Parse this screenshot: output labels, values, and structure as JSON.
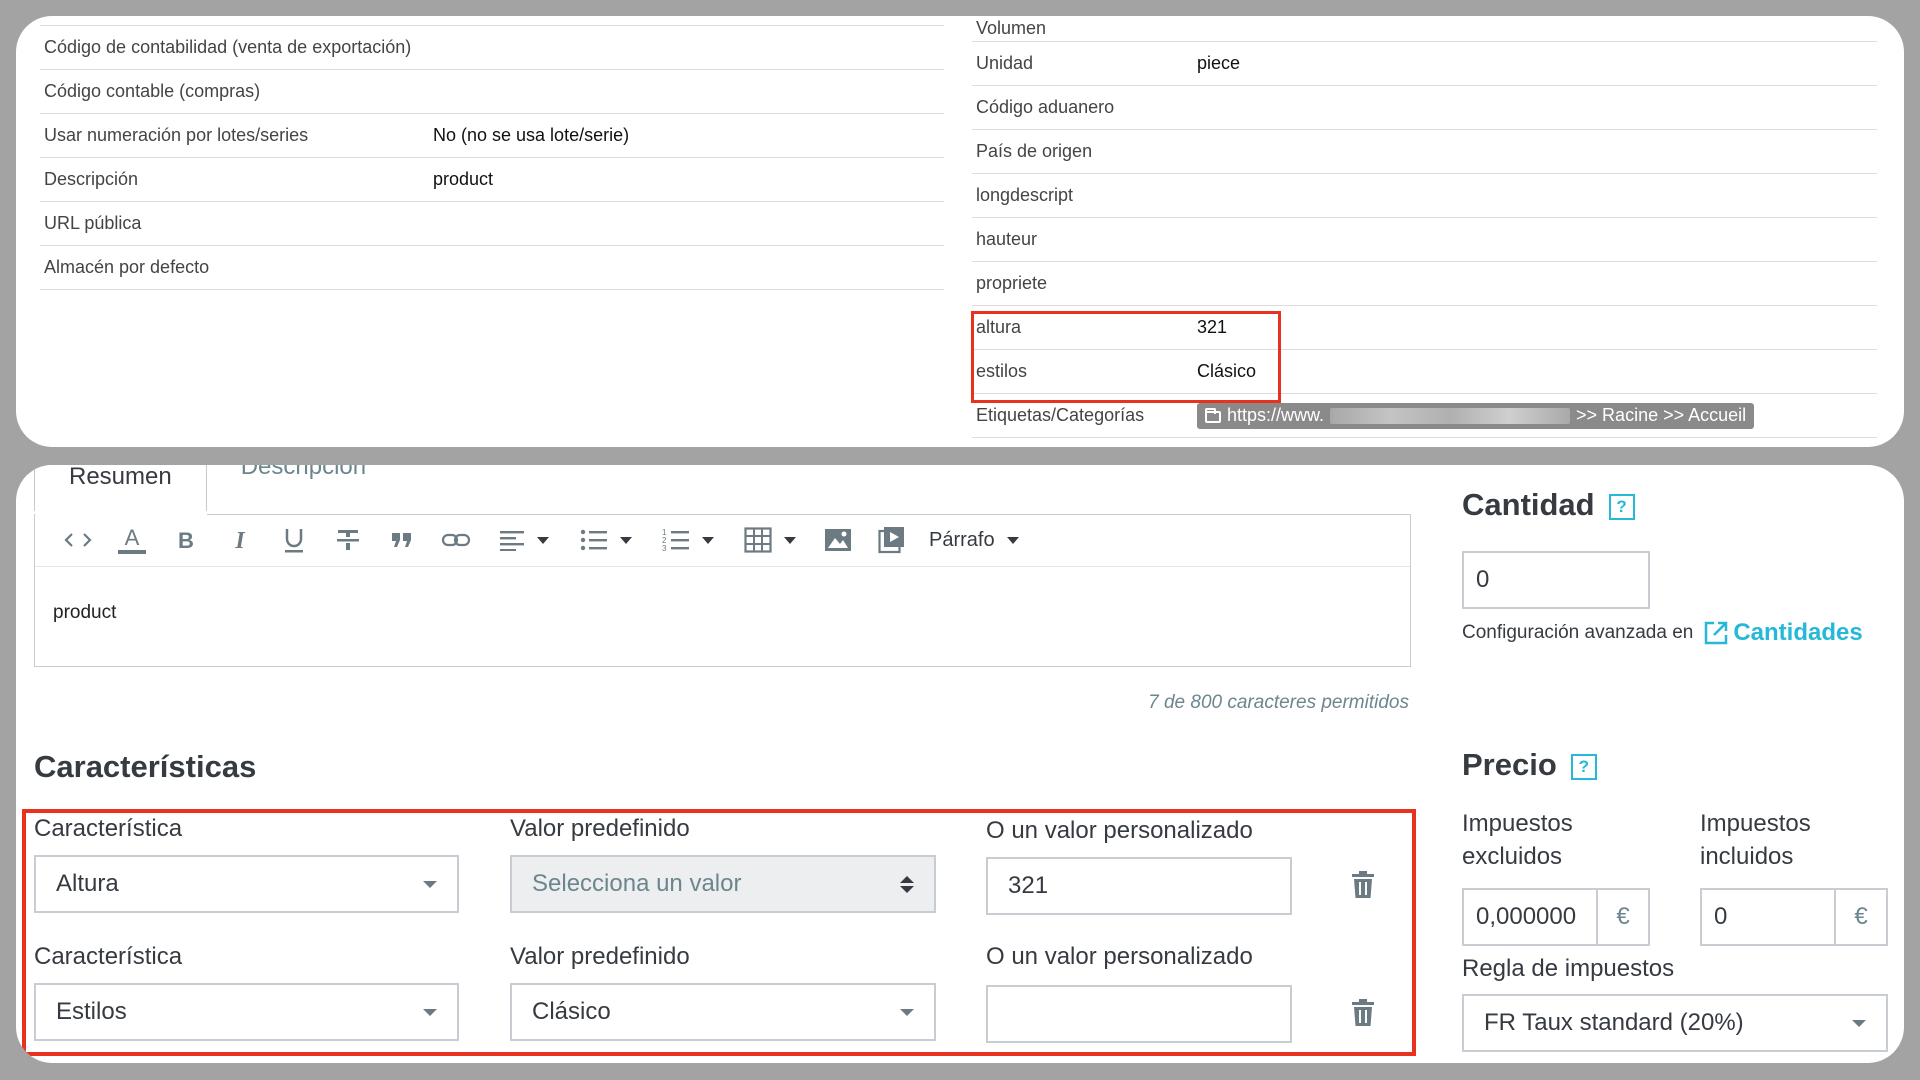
{
  "product_info": {
    "left_rows": [
      {
        "label": "Código de contabilidad (venta de exportación)",
        "value": ""
      },
      {
        "label": "Código contable (compras)",
        "value": ""
      },
      {
        "label": "Usar numeración por lotes/series",
        "value": "No (no se usa lote/serie)"
      },
      {
        "label": "Descripción",
        "value": "product"
      },
      {
        "label": "URL pública",
        "value": ""
      },
      {
        "label": "Almacén por defecto",
        "value": ""
      }
    ],
    "right_first_label": "Volumen",
    "right_rows": [
      {
        "label": "Unidad",
        "value": "piece"
      },
      {
        "label": "Código aduanero",
        "value": ""
      },
      {
        "label": "País de origen",
        "value": ""
      },
      {
        "label": "longdescript",
        "value": ""
      },
      {
        "label": "hauteur",
        "value": ""
      },
      {
        "label": "propriete",
        "value": ""
      },
      {
        "label": "altura",
        "value": "321"
      },
      {
        "label": "estilos",
        "value": "Clásico"
      }
    ],
    "tags": {
      "label": "Etiquetas/Categorías",
      "url_prefix": "https://www.",
      "path": ">> Racine >> Accueil"
    }
  },
  "editor": {
    "tabs": [
      {
        "label": "Resumen",
        "active": true
      },
      {
        "label": "Descripción",
        "active": false
      }
    ],
    "toolbar": {
      "tools": [
        "code-view",
        "text-color",
        "bold",
        "italic",
        "underline",
        "strikethrough",
        "quote",
        "link",
        "align",
        "bullet-list",
        "numbered-list",
        "table",
        "image",
        "video"
      ],
      "paragraph_label": "Párrafo"
    },
    "content": "product",
    "char_count": "7 de 800 caracteres permitidos"
  },
  "features": {
    "title": "Características",
    "rows": [
      {
        "feature_label": "Característica",
        "feature_value": "Altura",
        "predefined_label": "Valor predefinido",
        "predefined_value": "Selecciona un valor",
        "custom_label": "O un valor personalizado",
        "custom_value": "321"
      },
      {
        "feature_label": "Característica",
        "feature_value": "Estilos",
        "predefined_label": "Valor predefinido",
        "predefined_value": "Clásico",
        "custom_label": "O un valor personalizado",
        "custom_value": ""
      }
    ]
  },
  "quantity": {
    "title": "Cantidad",
    "help": "?",
    "value": "0",
    "advanced_text": "Configuración avanzada en",
    "advanced_link": "Cantidades"
  },
  "price": {
    "title": "Precio",
    "help": "?",
    "tax_excl_label": "Impuestos excluidos",
    "tax_excl_value": "0,000000",
    "tax_incl_label": "Impuestos incluidos",
    "tax_incl_value": "0",
    "currency": "€",
    "tax_rule_label": "Regla de impuestos",
    "tax_rule_value": "FR Taux standard (20%)"
  },
  "colors": {
    "highlight": "#e8321f",
    "accent": "#25b9d7",
    "text_dark": "#363a41",
    "text_muted": "#6c868e"
  }
}
